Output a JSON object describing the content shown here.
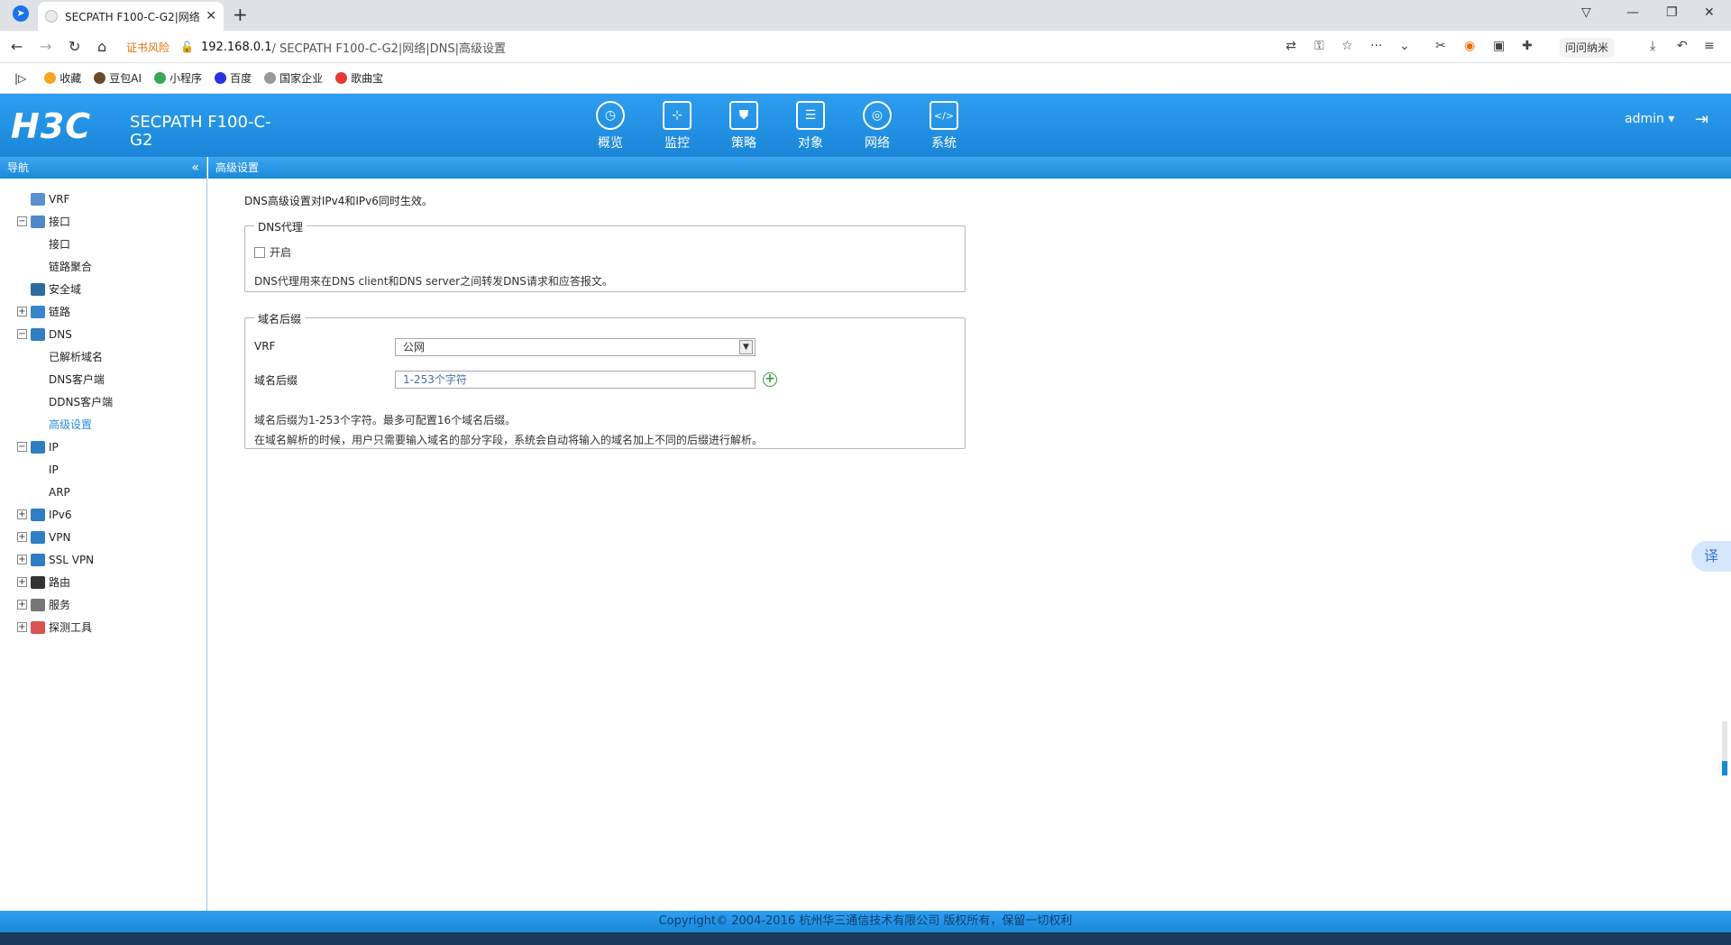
{
  "browser": {
    "tab_title": "SECPATH F100-C-G2|网络|",
    "tab_close": "✕",
    "new_tab": "+",
    "cert_warning": "证书风险",
    "url_host": "192.168.0.1",
    "url_path": " / SECPATH F100-C-G2|网络|DNS|高级设置",
    "ext_label": "问问纳米"
  },
  "bookmarks": [
    {
      "label": "收藏",
      "color": "#f5a623"
    },
    {
      "label": "豆包AI",
      "color": "#6b4a2b"
    },
    {
      "label": "小程序",
      "color": "#34a853"
    },
    {
      "label": "百度",
      "color": "#2932e1"
    },
    {
      "label": "国家企业",
      "color": "#999999"
    },
    {
      "label": "歌曲宝",
      "color": "#e53935"
    }
  ],
  "header": {
    "logo": "H3C",
    "product": "SECPATH F100-C-G2",
    "menu": [
      {
        "label": "概览",
        "icon": "◷"
      },
      {
        "label": "监控",
        "icon": "⊹"
      },
      {
        "label": "策略",
        "icon": "⛊"
      },
      {
        "label": "对象",
        "icon": "☰"
      },
      {
        "label": "网络",
        "icon": "◎"
      },
      {
        "label": "系统",
        "icon": "</>"
      }
    ],
    "user": "admin ▾"
  },
  "sidebar": {
    "title": "导航",
    "items": [
      {
        "label": "VRF",
        "type": "node-leaf",
        "color": "#5a8fd0"
      },
      {
        "label": "接口",
        "type": "node-open",
        "color": "#4f88c6"
      },
      {
        "label": "接口",
        "type": "child"
      },
      {
        "label": "链路聚合",
        "type": "child"
      },
      {
        "label": "安全域",
        "type": "node-leaf",
        "color": "#2d6b9c"
      },
      {
        "label": "链路",
        "type": "node-closed",
        "color": "#3a86c8"
      },
      {
        "label": "DNS",
        "type": "node-open",
        "color": "#2f7ec4"
      },
      {
        "label": "已解析域名",
        "type": "child"
      },
      {
        "label": "DNS客户端",
        "type": "child"
      },
      {
        "label": "DDNS客户端",
        "type": "child"
      },
      {
        "label": "高级设置",
        "type": "child-active"
      },
      {
        "label": "IP",
        "type": "node-open",
        "color": "#2f7ec4"
      },
      {
        "label": "IP",
        "type": "child"
      },
      {
        "label": "ARP",
        "type": "child"
      },
      {
        "label": "IPv6",
        "type": "node-closed",
        "color": "#2f7ec4"
      },
      {
        "label": "VPN",
        "type": "node-closed",
        "color": "#2f7ec4"
      },
      {
        "label": "SSL VPN",
        "type": "node-closed",
        "color": "#2f7ec4"
      },
      {
        "label": "路由",
        "type": "node-closed",
        "color": "#333333"
      },
      {
        "label": "服务",
        "type": "node-closed",
        "color": "#777777"
      },
      {
        "label": "探测工具",
        "type": "node-closed",
        "color": "#d9534f"
      }
    ]
  },
  "content": {
    "title": "高级设置",
    "intro": "DNS高级设置对IPv4和IPv6同时生效。",
    "dns_proxy": {
      "legend": "DNS代理",
      "enable_label": "开启",
      "note": "DNS代理用来在DNS client和DNS server之间转发DNS请求和应答报文。"
    },
    "domain_suffix": {
      "legend": "域名后缀",
      "vrf_label": "VRF",
      "vrf_value": "公网",
      "suffix_label": "域名后缀",
      "suffix_placeholder": "1-253个字符",
      "note1": "域名后缀为1-253个字符。最多可配置16个域名后缀。",
      "note2": "在域名解析的时候，用户只需要输入域名的部分字段，系统会自动将输入的域名加上不同的后缀进行解析。"
    }
  },
  "footer": {
    "copyright": "Copyright© 2004-2016 杭州华三通信技术有限公司 版权所有，保留一切权利"
  },
  "translate_label": "译"
}
